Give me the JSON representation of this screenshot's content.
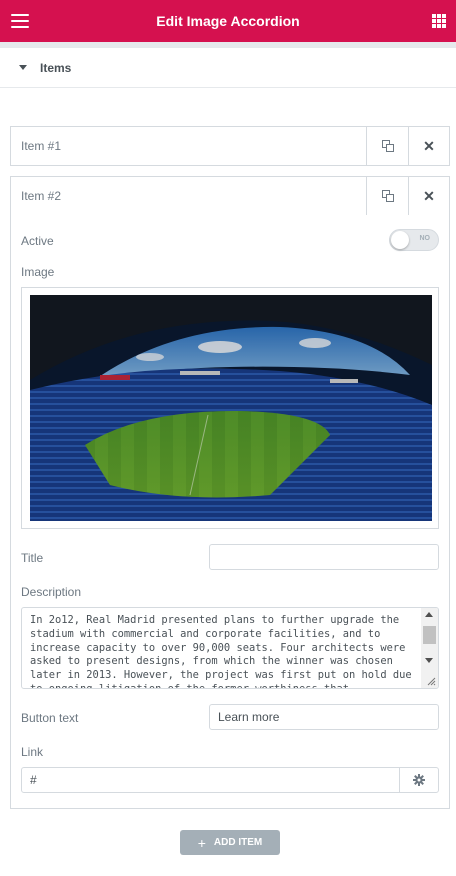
{
  "header": {
    "title": "Edit Image Accordion",
    "menu_icon": "hamburger-icon",
    "apps_icon": "grid-icon",
    "color": "#d5114f"
  },
  "section": {
    "label": "Items",
    "caret_icon": "caret-down-icon"
  },
  "items": [
    {
      "label": "Item #1",
      "duplicate_icon": "copy-icon",
      "remove_icon": "close-icon"
    },
    {
      "label": "Item #2",
      "duplicate_icon": "copy-icon",
      "remove_icon": "close-icon"
    }
  ],
  "item_editor": {
    "active": {
      "label": "Active",
      "toggle_text": "NO",
      "value": false
    },
    "image": {
      "label": "Image",
      "content": "stadium photo"
    },
    "title": {
      "label": "Title",
      "value": ""
    },
    "description": {
      "label": "Description",
      "value": "In 2o12, Real Madrid presented plans to further upgrade the stadium with commercial and corporate facilities, and to increase capacity to over 90,000 seats. Four architects were asked to present designs, from which the winner was chosen later in 2013. However, the project was first put on hold due to ongoing litigation of the former worthiness that"
    },
    "button_text": {
      "label": "Button text",
      "value": "Learn more"
    },
    "link": {
      "label": "Link",
      "value": "#",
      "settings_icon": "gear-icon"
    }
  },
  "add_item": {
    "label": "ADD ITEM",
    "icon": "plus-icon"
  }
}
